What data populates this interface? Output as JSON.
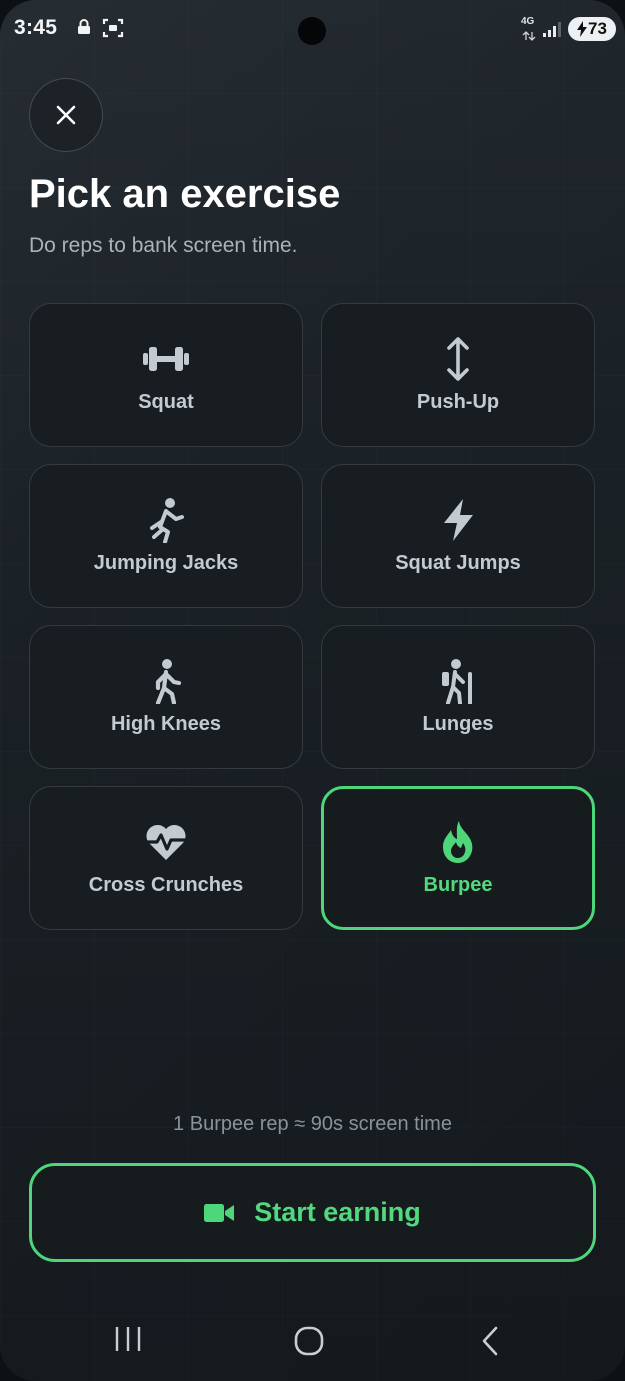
{
  "status_bar": {
    "time": "3:45",
    "network": "4G",
    "battery": "73"
  },
  "header": {
    "title": "Pick an exercise",
    "subtitle": "Do reps to bank screen time."
  },
  "exercises": [
    {
      "label": "Squat",
      "icon": "dumbbell-icon",
      "selected": false
    },
    {
      "label": "Push-Up",
      "icon": "vertical-arrows-icon",
      "selected": false
    },
    {
      "label": "Jumping Jacks",
      "icon": "running-person-icon",
      "selected": false
    },
    {
      "label": "Squat Jumps",
      "icon": "lightning-bolt-icon",
      "selected": false
    },
    {
      "label": "High Knees",
      "icon": "walking-person-icon",
      "selected": false
    },
    {
      "label": "Lunges",
      "icon": "hiking-person-icon",
      "selected": false
    },
    {
      "label": "Cross Crunches",
      "icon": "heart-pulse-icon",
      "selected": false
    },
    {
      "label": "Burpee",
      "icon": "fire-icon",
      "selected": true
    }
  ],
  "hint": "1 Burpee rep ≈ 90s screen time",
  "start_button": {
    "label": "Start earning",
    "icon": "video-camera-icon"
  },
  "colors": {
    "accent": "#4ed67a",
    "card_bg": "#181d21",
    "muted_text": "#8a939a"
  }
}
